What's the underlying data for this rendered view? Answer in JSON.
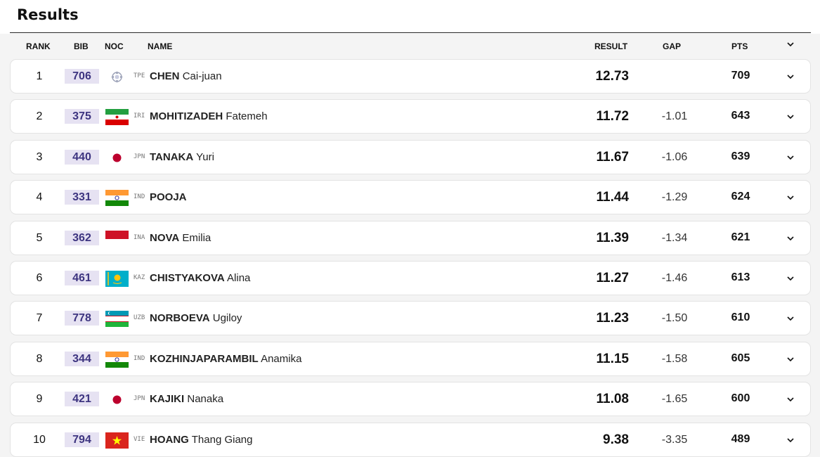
{
  "page": {
    "title": "Results"
  },
  "header": {
    "rank": "RANK",
    "bib": "BIB",
    "noc": "NOC",
    "name": "NAME",
    "result": "RESULT",
    "gap": "GAP",
    "pts": "PTS"
  },
  "rows": [
    {
      "rank": "1",
      "bib": "706",
      "noc": "TPE",
      "family": "CHEN",
      "given": "Cai-juan",
      "result": "12.73",
      "gap": "",
      "pts": "709",
      "flag_icon": "tpe-flag-icon"
    },
    {
      "rank": "2",
      "bib": "375",
      "noc": "IRI",
      "family": "MOHITIZADEH",
      "given": "Fatemeh",
      "result": "11.72",
      "gap": "-1.01",
      "pts": "643",
      "flag_icon": "iri-flag-icon"
    },
    {
      "rank": "3",
      "bib": "440",
      "noc": "JPN",
      "family": "TANAKA",
      "given": "Yuri",
      "result": "11.67",
      "gap": "-1.06",
      "pts": "639",
      "flag_icon": "jpn-flag-icon"
    },
    {
      "rank": "4",
      "bib": "331",
      "noc": "IND",
      "family": "POOJA",
      "given": "",
      "result": "11.44",
      "gap": "-1.29",
      "pts": "624",
      "flag_icon": "ind-flag-icon"
    },
    {
      "rank": "5",
      "bib": "362",
      "noc": "INA",
      "family": "NOVA",
      "given": "Emilia",
      "result": "11.39",
      "gap": "-1.34",
      "pts": "621",
      "flag_icon": "ina-flag-icon"
    },
    {
      "rank": "6",
      "bib": "461",
      "noc": "KAZ",
      "family": "CHISTYAKOVA",
      "given": "Alina",
      "result": "11.27",
      "gap": "-1.46",
      "pts": "613",
      "flag_icon": "kaz-flag-icon"
    },
    {
      "rank": "7",
      "bib": "778",
      "noc": "UZB",
      "family": "NORBOEVA",
      "given": "Ugiloy",
      "result": "11.23",
      "gap": "-1.50",
      "pts": "610",
      "flag_icon": "uzb-flag-icon"
    },
    {
      "rank": "8",
      "bib": "344",
      "noc": "IND",
      "family": "KOZHINJAPARAMBIL",
      "given": "Anamika",
      "result": "11.15",
      "gap": "-1.58",
      "pts": "605",
      "flag_icon": "ind-flag-icon"
    },
    {
      "rank": "9",
      "bib": "421",
      "noc": "JPN",
      "family": "KAJIKI",
      "given": "Nanaka",
      "result": "11.08",
      "gap": "-1.65",
      "pts": "600",
      "flag_icon": "jpn-flag-icon"
    },
    {
      "rank": "10",
      "bib": "794",
      "noc": "VIE",
      "family": "HOANG",
      "given": "Thang Giang",
      "result": "9.38",
      "gap": "-3.35",
      "pts": "489",
      "flag_icon": "vie-flag-icon"
    }
  ],
  "colors": {
    "bib_bg": "#e6e2f2",
    "bib_text": "#3d3480",
    "row_bg": "#ffffff",
    "page_bg": "#f4f4f4"
  }
}
